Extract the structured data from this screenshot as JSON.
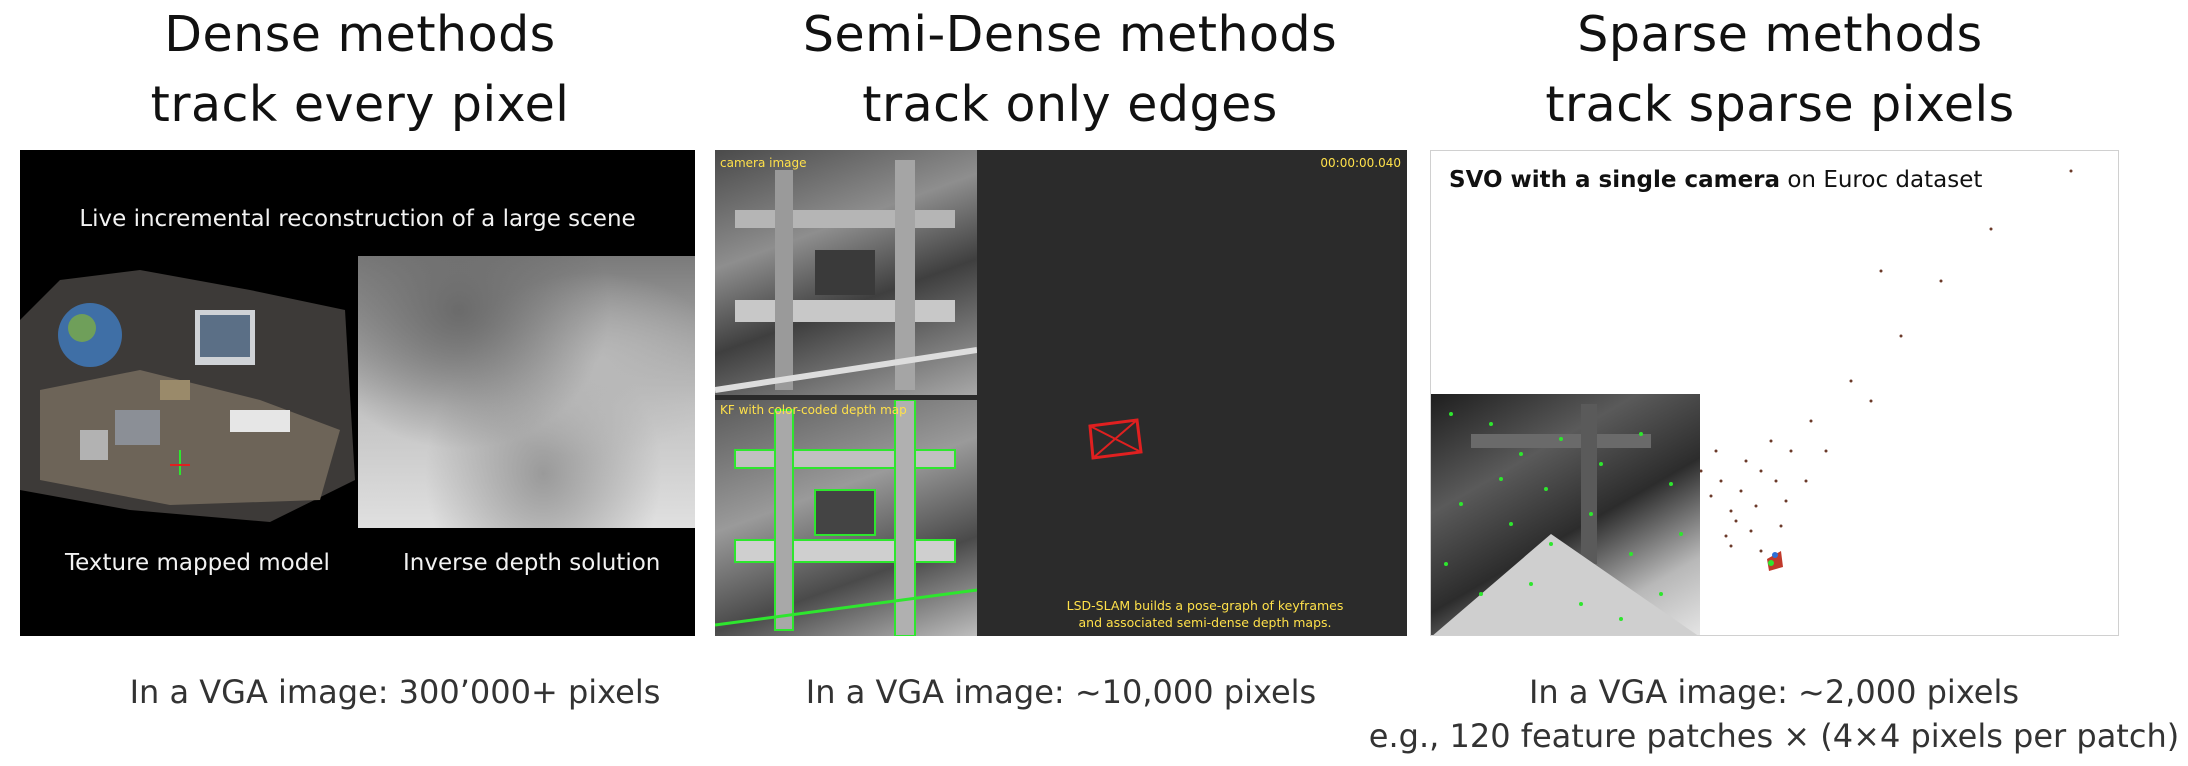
{
  "columns": [
    {
      "title_line1": "Dense methods",
      "title_line2": "track every pixel",
      "caption_line1": "In a VGA image: 300’000+ pixels",
      "caption_line2": ""
    },
    {
      "title_line1": "Semi-Dense methods",
      "title_line2": "track only edges",
      "caption_line1": "In a VGA image: ~10,000 pixels",
      "caption_line2": ""
    },
    {
      "title_line1": "Sparse methods",
      "title_line2": "track sparse pixels",
      "caption_line1": "In a VGA image: ~2,000 pixels",
      "caption_line2": "e.g., 120 feature patches × (4×4 pixels per patch)"
    }
  ],
  "dense_panel": {
    "top_label": "Live incremental reconstruction of a large scene",
    "left_label": "Texture mapped model",
    "right_label": "Inverse depth solution"
  },
  "semidense_panel": {
    "camera_label": "camera image",
    "kf_label": "KF with color-coded depth map",
    "timestamp": "00:00:00.040",
    "note_line1": "LSD-SLAM builds a pose-graph of keyframes",
    "note_line2": "and associated semi-dense depth maps.",
    "colors": {
      "label": "#ffe14a",
      "camera_frustum": "#e02020",
      "edges": "#2ee62e"
    }
  },
  "sparse_panel": {
    "title_bold": "SVO with a single camera",
    "title_rest": " on Euroc dataset",
    "colors": {
      "features": "#2ee62e",
      "points": "#6b3a2a"
    }
  }
}
